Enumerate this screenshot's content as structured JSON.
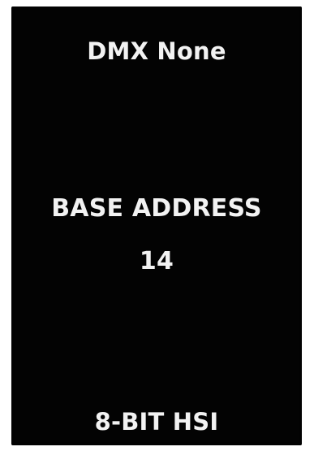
{
  "display": {
    "status": "DMX None",
    "heading": "BASE ADDRESS",
    "value": "14",
    "mode": "8-BIT HSI"
  },
  "colors": {
    "screen": "#030303",
    "text": "#f2f2f2",
    "bezel": "#ffffff"
  }
}
